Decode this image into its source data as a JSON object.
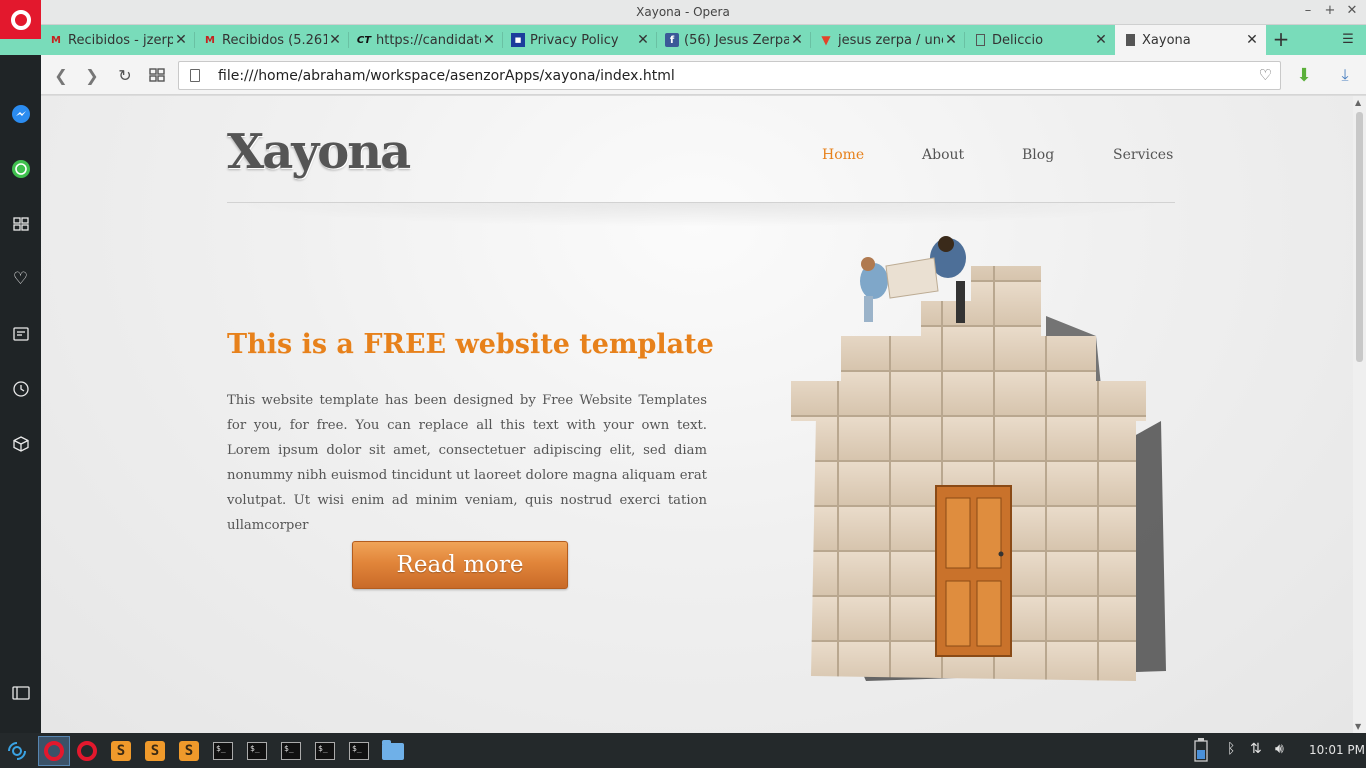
{
  "window": {
    "title": "Xayona - Opera"
  },
  "tabs": [
    {
      "label": "Recibidos - jzerpa",
      "favicon": "gmail-icon",
      "favicon_color": "#c5221f"
    },
    {
      "label": "Recibidos (5.261)",
      "favicon": "gmail-icon",
      "favicon_color": "#c5221f"
    },
    {
      "label": "https://candidatos",
      "favicon": "ct-icon",
      "favicon_color": "#111111"
    },
    {
      "label": "Privacy Policy",
      "favicon": "site-icon",
      "favicon_color": "#1c3c9c"
    },
    {
      "label": "(56) Jesus Zerpa",
      "favicon": "facebook-icon",
      "favicon_color": "#3b5998"
    },
    {
      "label": "jesus zerpa / unexpo",
      "favicon": "gitlab-icon",
      "favicon_color": "#e24329"
    },
    {
      "label": "Deliccio",
      "favicon": "page-icon",
      "favicon_color": "#555555"
    },
    {
      "label": "Xayona",
      "favicon": "page-icon",
      "favicon_color": "#555555",
      "active": true
    }
  ],
  "address_bar": {
    "url": "file:///home/abraham/workspace/asenzorApps/xayona/index.html"
  },
  "page": {
    "logo": "Xayona",
    "nav": [
      "Home",
      "About",
      "Blog",
      "Services"
    ],
    "active_nav": "Home",
    "headline": "This is a FREE website template",
    "body": "This website template has been designed by Free Website Templates for you, for free. You can replace all this text with your own text. Lorem ipsum dolor sit amet, consectetuer adipiscing elit, sed diam nonummy nibh euismod tincidunt ut laoreet dolore magna aliquam erat volutpat. Ut wisi enim ad minim veniam, quis nostrud exerci tation ullamcorper",
    "button": "Read more",
    "accent_color": "#e7811b"
  },
  "sidebar": {
    "items": [
      "messenger-icon",
      "whatsapp-icon",
      "speed-dial-icon",
      "bookmarks-icon",
      "news-icon",
      "history-icon",
      "extensions-icon"
    ]
  },
  "taskbar": {
    "clock": "10:01 PM"
  }
}
